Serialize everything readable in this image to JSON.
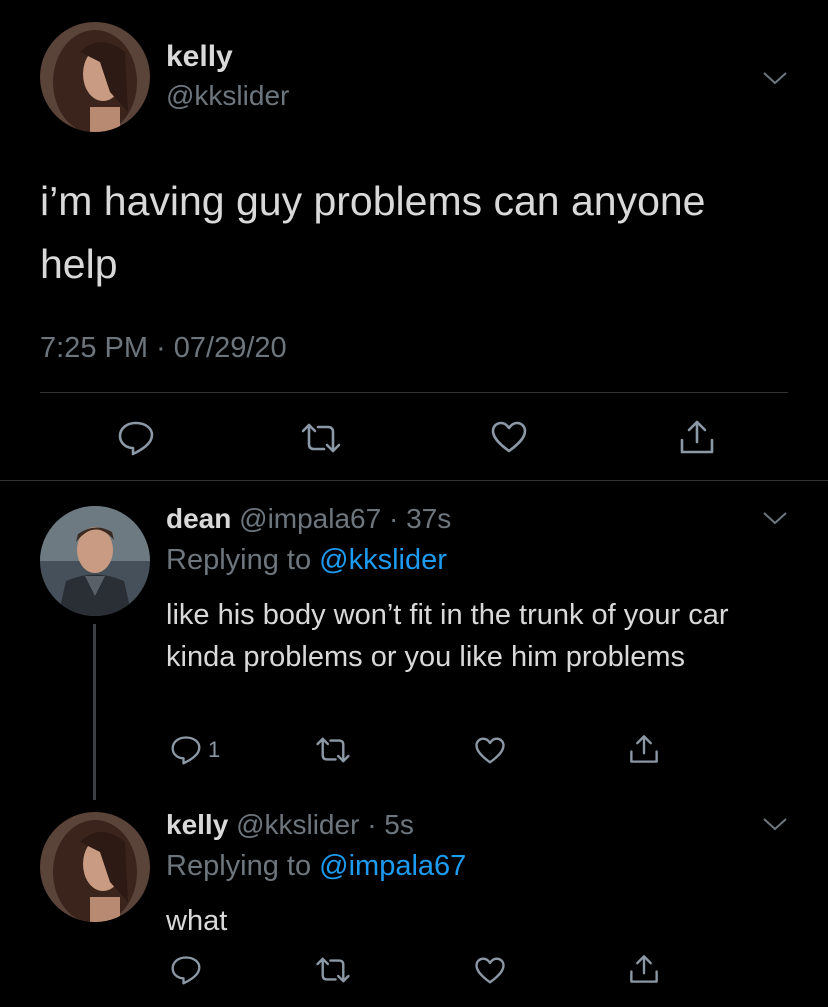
{
  "main_tweet": {
    "display_name": "kelly",
    "handle": "@kkslider",
    "text": "i’m having guy problems can anyone help",
    "timestamp": "7:25 PM · 07/29/20"
  },
  "replies": [
    {
      "display_name": "dean",
      "handle": "@impala67",
      "time": "· 37s",
      "replying_label": "Replying to",
      "replying_handle": "@kkslider",
      "text": "like his body won’t fit in the trunk of your car kinda problems or you like him problems",
      "reply_count": "1"
    },
    {
      "display_name": "kelly",
      "handle": "@kkslider",
      "time": "· 5s",
      "replying_label": "Replying to",
      "replying_handle": "@impala67",
      "text": "what",
      "reply_count": ""
    }
  ],
  "colors": {
    "background": "#000000",
    "text": "#d9d9d9",
    "muted": "#6e767d",
    "link": "#1d9bf0",
    "divider": "#2f3336"
  },
  "icons": [
    "reply-icon",
    "retweet-icon",
    "like-icon",
    "share-icon",
    "chevron-down-icon"
  ]
}
